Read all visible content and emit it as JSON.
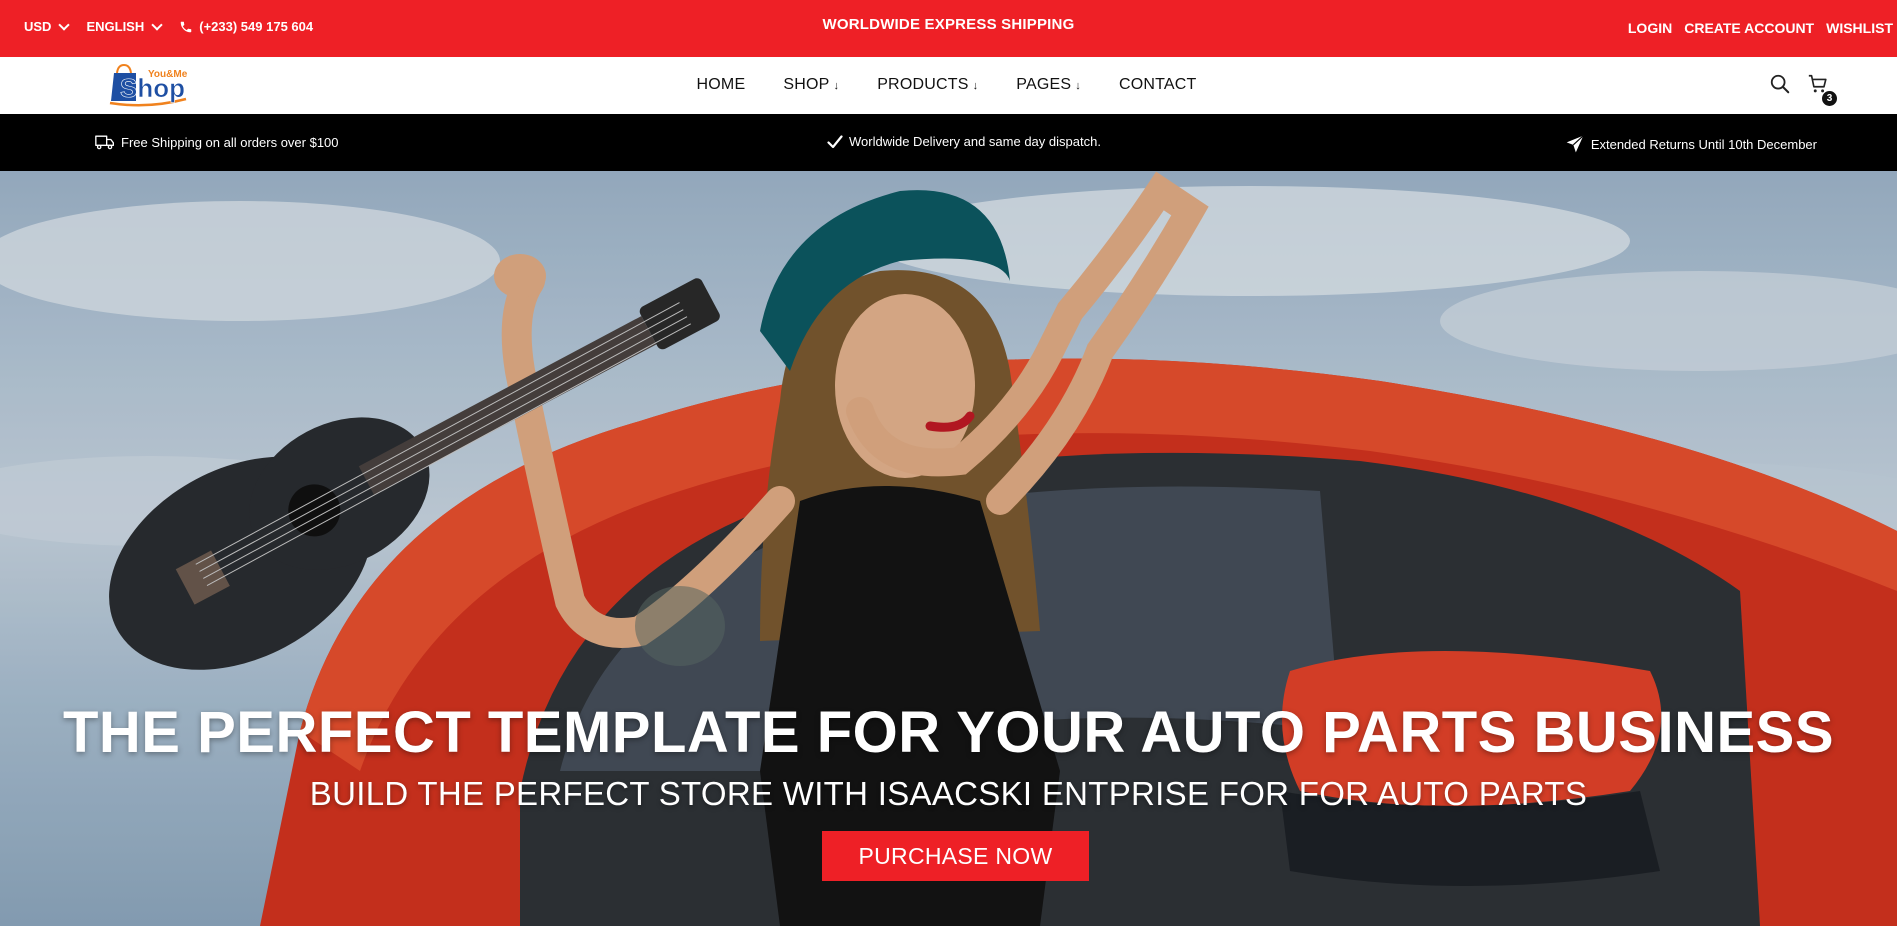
{
  "topbar": {
    "currency": "USD",
    "language": "ENGLISH",
    "phone": "(+233) 549 175 604",
    "announcement": "WORLDWIDE EXPRESS SHIPPING",
    "links": {
      "login": "LOGIN",
      "create_account": "CREATE ACCOUNT",
      "wishlist": "WISHLIST"
    },
    "background": "#ee2026"
  },
  "logo": {
    "small": "You&Me",
    "main": "Shop"
  },
  "nav": {
    "items": [
      {
        "label": "HOME",
        "arrow": ""
      },
      {
        "label": "SHOP",
        "arrow": "↓"
      },
      {
        "label": "PRODUCTS",
        "arrow": "↓"
      },
      {
        "label": "PAGES",
        "arrow": "↓"
      },
      {
        "label": "CONTACT",
        "arrow": ""
      }
    ],
    "cart_count": "3",
    "icons": [
      "search-icon",
      "cart-icon"
    ]
  },
  "infobar": {
    "shipping": "Free Shipping on all orders over $100",
    "delivery": "Worldwide Delivery and same day dispatch.",
    "returns": "Extended Returns Until 10th December",
    "icons": [
      "truck-icon",
      "check-icon",
      "paper-plane-icon"
    ]
  },
  "hero": {
    "title": "THE PERFECT TEMPLATE FOR YOUR AUTO PARTS BUSINESS",
    "subtitle": "BUILD THE PERFECT STORE WITH ISAACSKI ENTPRISE FOR FOR AUTO PARTS",
    "button": "PURCHASE NOW",
    "accent": "#ee2026"
  }
}
